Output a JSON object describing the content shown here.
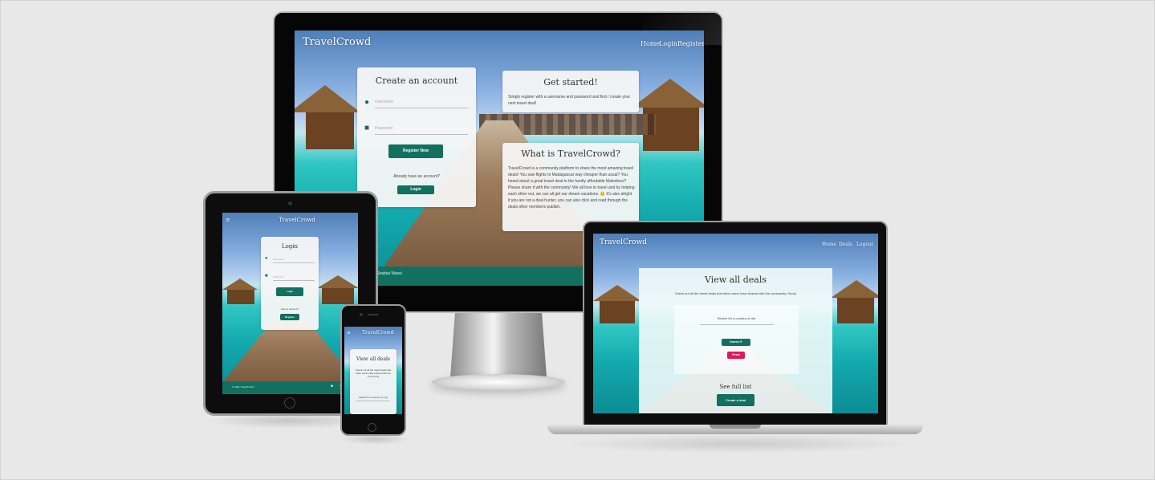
{
  "brand": "TravelCrowd",
  "desktop": {
    "nav": [
      "Home",
      "Login",
      "Register"
    ],
    "create": {
      "title": "Create an account",
      "username_ph": "Username",
      "password_ph": "Password",
      "register_btn": "Register Now",
      "already": "Already have an account?",
      "login_btn": "Login"
    },
    "started": {
      "title": "Get started!",
      "text": "Simply register with a username and password and find / create your next travel deal!"
    },
    "what": {
      "title": "What is TravelCrowd?",
      "text": "TravelCrowd is a community platform to share the most amazing travel deals! You saw flights to Madagascar way cheaper than usual? You heard about a great travel deal to the hardly affordable Maledives? Please share it with the community! We all love to travel and by helping each other out, we can all get our dream vacations. 😊 It's also alright if you are not a deal hunter, you can also click and read through the deals other members publish."
    },
    "footer": "Shabtai Wassi"
  },
  "tablet": {
    "login_title": "Login",
    "username_ph": "Username",
    "password_ph": "Password",
    "login_btn": "Login",
    "no_account": "New to account?",
    "register_btn": "Register",
    "footer": "© 2021 TravelCrowd"
  },
  "phone": {
    "title": "View all deals",
    "subtitle": "Check out all the travel deals that other users have shared with the community",
    "search_ph": "Search for a country or city"
  },
  "laptop": {
    "nav": [
      "Home",
      "Deals",
      "Logout"
    ],
    "title": "View all deals",
    "subtitle": "Check out all the travel deals that other users have shared with the community. Hurry!",
    "search_ph": "Search for a country or city",
    "search_btn": "Search",
    "reset_btn": "Reset",
    "full_list": "See full list",
    "create_btn": "Create a deal"
  },
  "colors": {
    "accent": "#11705f",
    "reset": "#e0195a",
    "background": "#e8e8e8"
  }
}
